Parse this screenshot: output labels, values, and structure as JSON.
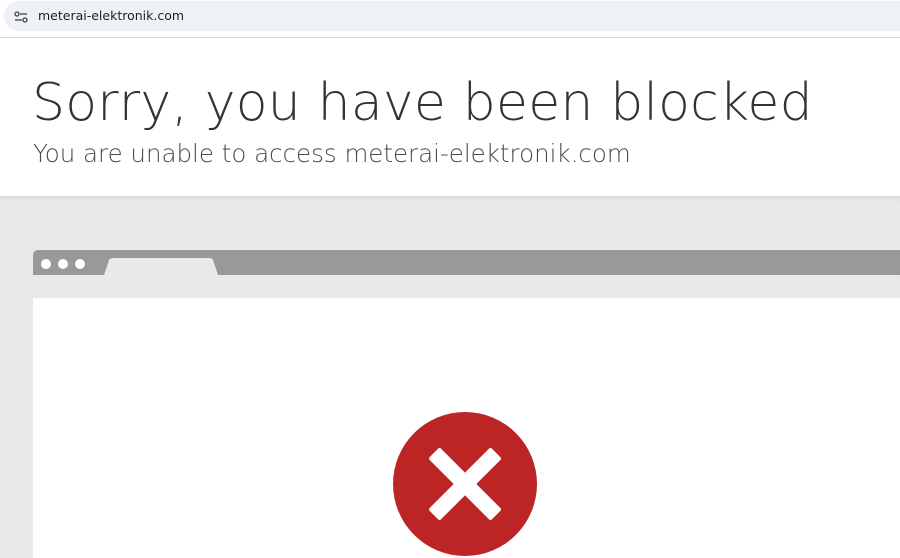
{
  "address_bar": {
    "url": "meterai-elektronik.com",
    "site_info_icon": "tune-icon"
  },
  "block_page": {
    "title": "Sorry, you have been blocked",
    "subtitle": "You are unable to access meterai-elektronik.com",
    "status_icon": "blocked-x-icon",
    "colors": {
      "icon_red": "#bd2426",
      "browser_bar_grey": "#999999",
      "background_grey": "#e9e9e9"
    }
  }
}
